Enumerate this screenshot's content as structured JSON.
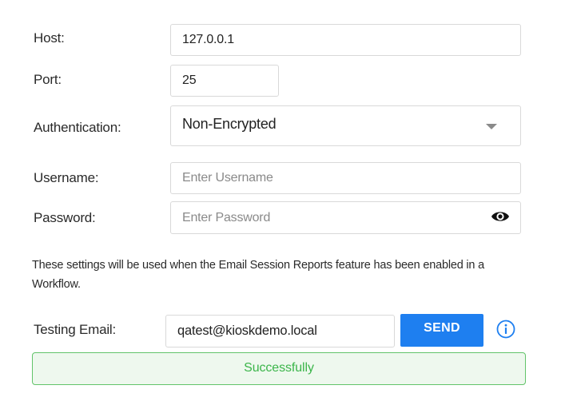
{
  "host": {
    "label": "Host:",
    "value": "127.0.0.1"
  },
  "port": {
    "label": "Port:",
    "value": "25"
  },
  "authentication": {
    "label": "Authentication:",
    "selected": "Non-Encrypted"
  },
  "username": {
    "label": "Username:",
    "value": "",
    "placeholder": "Enter Username"
  },
  "password": {
    "label": "Password:",
    "value": "",
    "placeholder": "Enter Password",
    "toggle_icon": "eye-icon"
  },
  "note": "These settings will be used when the Email Session Reports feature has been enabled in a Workflow.",
  "testing_email": {
    "label": "Testing Email:",
    "value": "qatest@kioskdemo.local",
    "send_label": "SEND",
    "info_icon": "info-icon"
  },
  "status": {
    "text": "Successfully"
  },
  "colors": {
    "accent": "#1e7ff0",
    "success_border": "#62c46a",
    "success_text": "#3bb54a",
    "success_bg": "#eef8ee",
    "field_border": "#d9d9d9"
  }
}
